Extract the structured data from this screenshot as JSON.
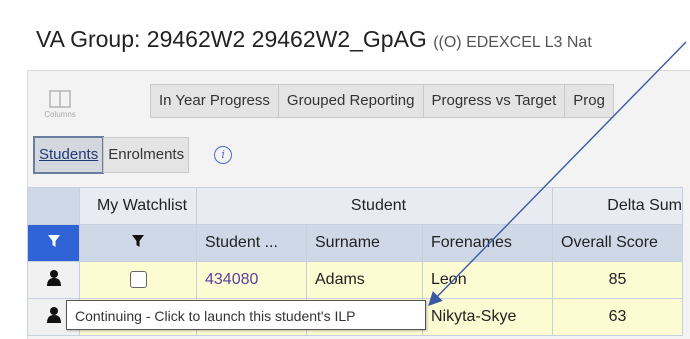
{
  "title": {
    "main": "VA Group: 29462W2 29462W2_GpAG",
    "qualifier": "((O) EDEXCEL L3 Nat"
  },
  "toolbar": {
    "columns_label": "Columns",
    "tabs": [
      "In Year Progress",
      "Grouped Reporting",
      "Progress vs Target",
      "Prog"
    ]
  },
  "subtabs": {
    "students": "Students",
    "enrolments": "Enrolments",
    "info_icon": "info-icon"
  },
  "grid": {
    "group_headers": {
      "watchlist": "My Watchlist",
      "student": "Student",
      "delta": "Delta Sum"
    },
    "column_headers": {
      "student_id": "Student ...",
      "surname": "Surname",
      "forenames": "Forenames",
      "overall_score": "Overall Score"
    },
    "rows": [
      {
        "student_id": "434080",
        "surname": "Adams",
        "forenames": "Leon",
        "overall_score": "85"
      },
      {
        "student_id": "",
        "surname": "",
        "forenames": "Nikyta-Skye",
        "overall_score": "63"
      }
    ]
  },
  "tooltip": {
    "text": "Continuing - Click to launch this student's ILP"
  },
  "colors": {
    "filter_blue": "#2f63d6",
    "row_highlight": "#fdfbd2",
    "arrow": "#3b5aa6"
  }
}
